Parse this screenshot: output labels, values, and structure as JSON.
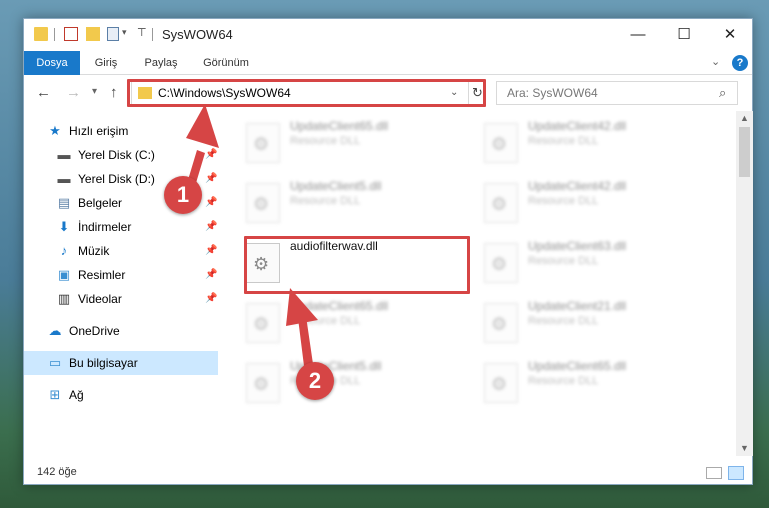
{
  "window": {
    "title": "SysWOW64",
    "minimize_icon": "minimize-icon",
    "maximize_icon": "maximize-icon",
    "close_icon": "close-icon"
  },
  "ribbon": {
    "tabs": [
      "Dosya",
      "Giriş",
      "Paylaş",
      "Görünüm"
    ],
    "file_tab_color": "#1979ca"
  },
  "navigation": {
    "address": "C:\\Windows\\SysWOW64",
    "search_placeholder": "Ara: SysWOW64"
  },
  "sidebar": {
    "items": [
      {
        "label": "Hızlı erişim",
        "icon": "star-icon",
        "pinned": false
      },
      {
        "label": "Yerel Disk (C:)",
        "icon": "drive-icon",
        "pinned": true
      },
      {
        "label": "Yerel Disk (D:)",
        "icon": "drive-icon",
        "pinned": true
      },
      {
        "label": "Belgeler",
        "icon": "documents-icon",
        "pinned": true
      },
      {
        "label": "İndirmeler",
        "icon": "download-icon",
        "pinned": true
      },
      {
        "label": "Müzik",
        "icon": "music-icon",
        "pinned": true
      },
      {
        "label": "Resimler",
        "icon": "pictures-icon",
        "pinned": true
      },
      {
        "label": "Videolar",
        "icon": "video-icon",
        "pinned": true
      },
      {
        "label": "OneDrive",
        "icon": "cloud-icon",
        "pinned": false
      },
      {
        "label": "Bu bilgisayar",
        "icon": "computer-icon",
        "pinned": false,
        "selected": true
      },
      {
        "label": "Ağ",
        "icon": "network-icon",
        "pinned": false
      }
    ]
  },
  "files": {
    "left": [
      {
        "name": "UpdateClient65.dll",
        "type": "Resource DLL",
        "blurred": true
      },
      {
        "name": "UpdateClient5.dll",
        "type": "Resource DLL",
        "blurred": true
      },
      {
        "name": "audiofilterwav.dll",
        "type": "",
        "blurred": false
      },
      {
        "name": "UpdateClient65.dll",
        "type": "Resource DLL",
        "blurred": true
      },
      {
        "name": "UpdateClient5.dll",
        "type": "Resource DLL",
        "blurred": true
      }
    ],
    "right": [
      {
        "name": "UpdateClient42.dll",
        "type": "Resource DLL",
        "blurred": true
      },
      {
        "name": "UpdateClient42.dll",
        "type": "Resource DLL",
        "blurred": true
      },
      {
        "name": "UpdateClient63.dll",
        "type": "Resource DLL",
        "blurred": true
      },
      {
        "name": "UpdateClient21.dll",
        "type": "Resource DLL",
        "blurred": true
      },
      {
        "name": "UpdateClient65.dll",
        "type": "Resource DLL",
        "blurred": true
      }
    ]
  },
  "status": {
    "item_count": "142 öğe"
  },
  "annotations": {
    "step1": "1",
    "step2": "2",
    "highlight_color": "#d64545"
  }
}
